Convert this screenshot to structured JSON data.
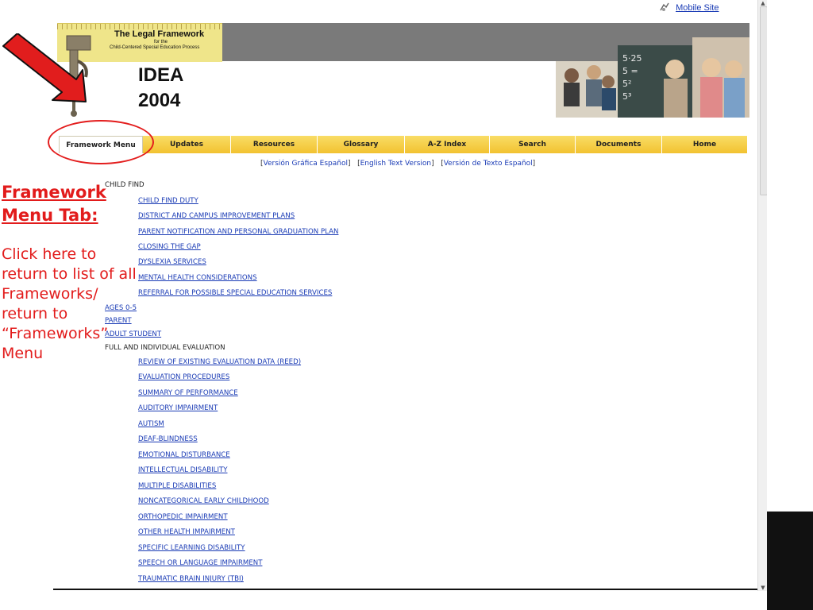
{
  "mobile_link": {
    "label": "Mobile Site",
    "icon": "mobile-icon"
  },
  "logo": {
    "title": "The Legal Framework",
    "sub1": "for the",
    "sub2": "Child-Centered Special Education Process",
    "idea_line1": "IDEA",
    "idea_line2": "2004"
  },
  "nav": {
    "tabs": [
      {
        "label": "Framework Menu",
        "active": true
      },
      {
        "label": "Updates"
      },
      {
        "label": "Resources"
      },
      {
        "label": "Glossary"
      },
      {
        "label": "A-Z Index"
      },
      {
        "label": "Search"
      },
      {
        "label": "Documents"
      },
      {
        "label": "Home"
      }
    ]
  },
  "language_links": {
    "graphic_spanish": "Versión Gráfica Español",
    "english_text": "English Text Version",
    "spanish_text": "Versión de Texto Español"
  },
  "menu": {
    "child_find": "CHILD FIND",
    "child_find_items": [
      "CHILD FIND DUTY",
      "DISTRICT AND CAMPUS IMPROVEMENT PLANS",
      "PARENT NOTIFICATION AND PERSONAL GRADUATION PLAN",
      "CLOSING THE GAP",
      "DYSLEXIA SERVICES",
      "MENTAL HEALTH CONSIDERATIONS",
      "REFERRAL FOR POSSIBLE SPECIAL EDUCATION SERVICES"
    ],
    "top_links": [
      "AGES 0-5",
      "PARENT",
      "ADULT STUDENT"
    ],
    "evaluation": "FULL AND INDIVIDUAL EVALUATION",
    "evaluation_items": [
      "REVIEW OF EXISTING EVALUATION DATA (REED)",
      "EVALUATION PROCEDURES",
      "SUMMARY OF PERFORMANCE",
      "AUDITORY IMPAIRMENT",
      "AUTISM",
      "DEAF-BLINDNESS",
      "EMOTIONAL DISTURBANCE",
      "INTELLECTUAL DISABILITY",
      "MULTIPLE DISABILITIES",
      "NONCATEGORICAL EARLY CHILDHOOD",
      "ORTHOPEDIC IMPAIRMENT",
      "OTHER HEALTH IMPAIRMENT",
      "SPECIFIC LEARNING DISABILITY",
      "SPEECH OR LANGUAGE IMPAIRMENT",
      "TRAUMATIC BRAIN INJURY (TBI)"
    ]
  },
  "callout": {
    "title_line1": "Framework",
    "title_line2": "Menu Tab:",
    "body": "Click here to return to list of all Frameworks/ return to “Frameworks” Menu"
  },
  "colors": {
    "nav_tab": "#f4c63a",
    "annotation_red": "#e21b1b",
    "link_blue": "#1a3bb5",
    "banner_gray": "#7a7a7a"
  }
}
